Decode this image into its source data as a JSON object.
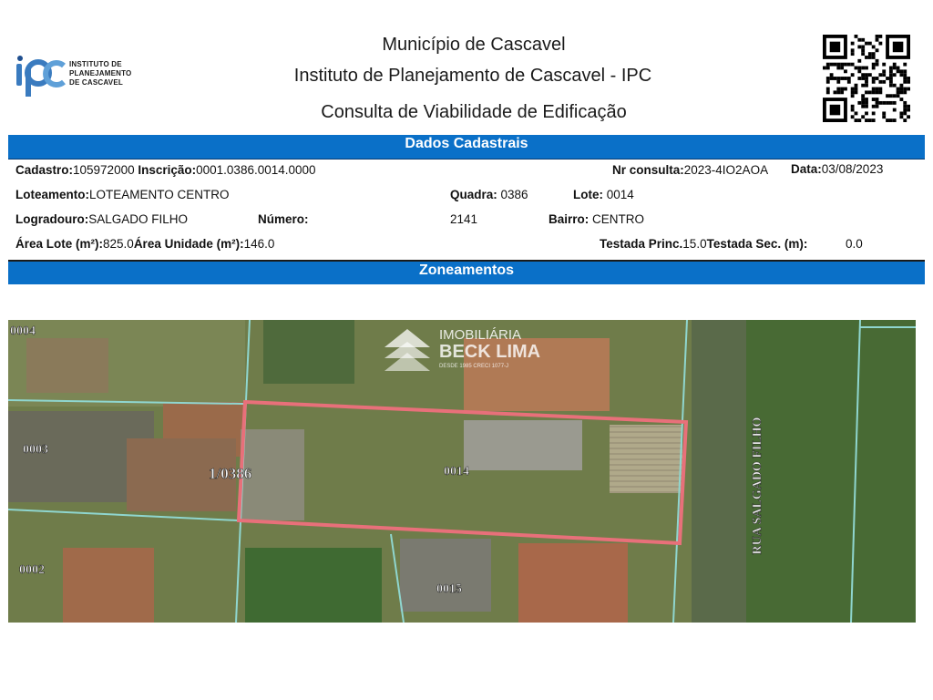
{
  "logo": {
    "short": "ipc",
    "line1": "INSTITUTO DE",
    "line2": "PLANEJAMENTO",
    "line3": "DE CASCAVEL"
  },
  "header": {
    "municipality": "Município de Cascavel",
    "institute": "Instituto de Planejamento de Cascavel - IPC",
    "document_title": "Consulta de Viabilidade de Edificação"
  },
  "sections": {
    "cadastral": "Dados Cadastrais",
    "zoning": "Zoneamentos"
  },
  "fields": {
    "cadastro_label": "Cadastro:",
    "cadastro_value": "105972000",
    "inscricao_label": "Inscrição:",
    "inscricao_value": "0001.0386.0014.0000",
    "nr_consulta_label": "Nr consulta:",
    "nr_consulta_value": "2023-4IO2AOA",
    "data_label": "Data:",
    "data_value": "03/08/2023",
    "loteamento_label": "Loteamento:",
    "loteamento_value": "LOTEAMENTO CENTRO",
    "quadra_label": "Quadra:",
    "quadra_value": "0386",
    "lote_label": "Lote:",
    "lote_value": "0014",
    "logradouro_label": "Logradouro:",
    "logradouro_value": "SALGADO FILHO",
    "numero_label": "Número:",
    "numero_value": "2141",
    "bairro_label": "Bairro:",
    "bairro_value": "CENTRO",
    "area_lote_label": "Área Lote (m²):",
    "area_lote_value": "825.0",
    "area_unidade_label": "Área Unidade (m²):",
    "area_unidade_value": "146.0",
    "testada_princ_label": "Testada Princ.",
    "testada_princ_value": "15.0",
    "testada_sec_label": "Testada  Sec. (m):",
    "testada_sec_value": "0.0"
  },
  "map": {
    "lot_labels": [
      "0004",
      "0003",
      "1/0386",
      "0014",
      "0002",
      "0015"
    ],
    "street_label": "RUA SALGADO FILHO",
    "highlight_color": "#e8707a"
  },
  "watermark": {
    "line1": "IMOBILIÁRIA",
    "line2": "BECK LIMA",
    "line3": "DESDE 1985 CRECI 1077-J"
  }
}
